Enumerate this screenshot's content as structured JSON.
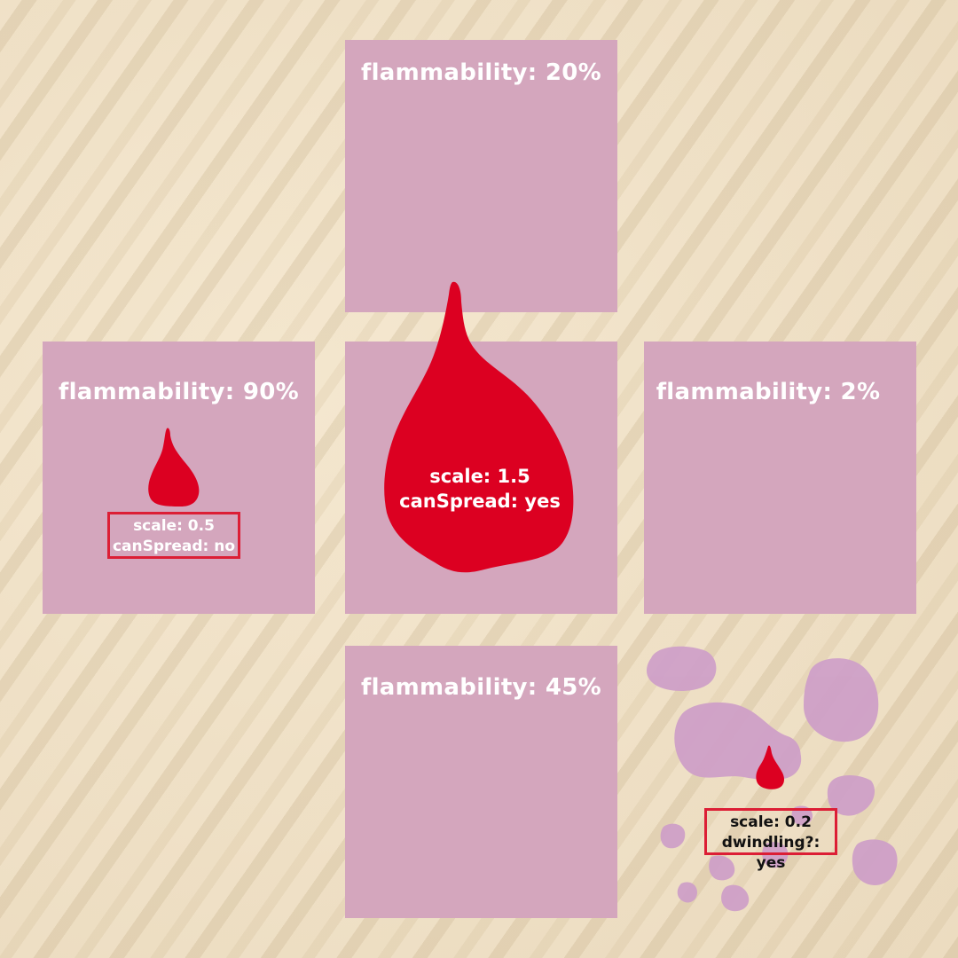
{
  "tiles": {
    "top": {
      "label": "flammability: 20%"
    },
    "left": {
      "label": "flammability: 90%"
    },
    "right": {
      "label": "flammability: 2%"
    },
    "bottom": {
      "label": "flammability: 45%"
    }
  },
  "drops": {
    "center": {
      "scale_text": "scale: 1.5",
      "status_text": "canSpread: yes"
    },
    "left": {
      "scale_text": "scale: 0.5",
      "status_text": "canSpread: no"
    },
    "puddle": {
      "scale_text": "scale: 0.2",
      "status_text": "dwindling?: yes"
    }
  },
  "colors": {
    "tile": "#d4a6bd",
    "drop": "#dc0021",
    "box_border": "#dc1e35",
    "puddle": "#cfa0c8",
    "background": "#ecdcc0"
  }
}
